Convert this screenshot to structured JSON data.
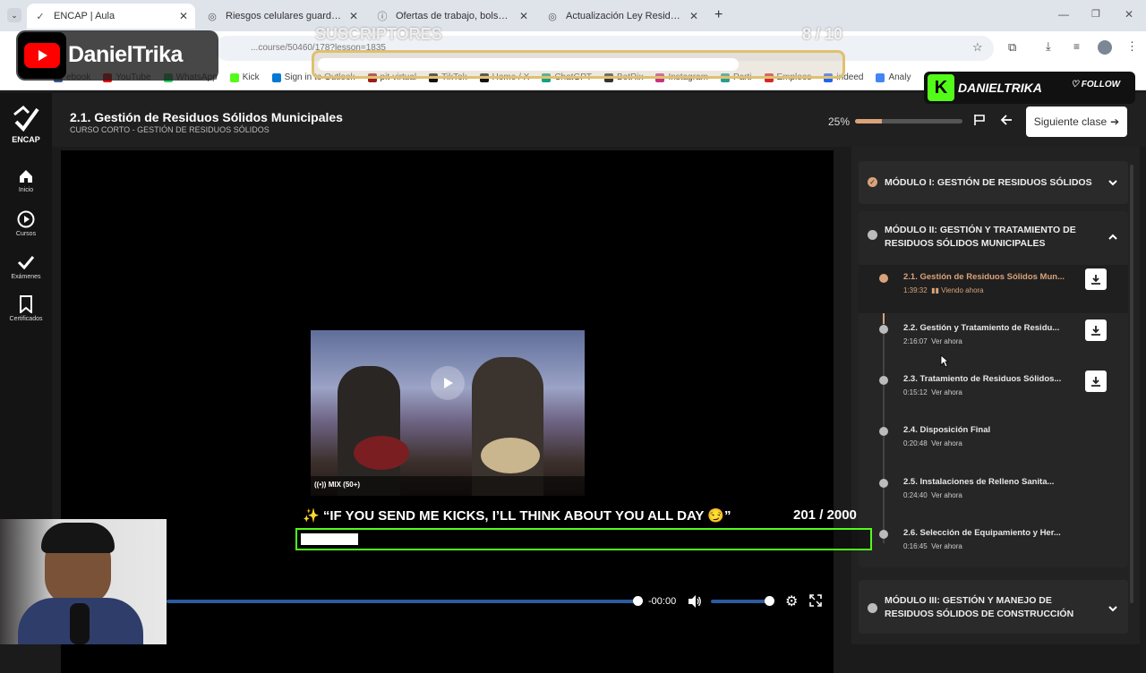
{
  "browser": {
    "tabs": [
      {
        "label": "ENCAP | Aula",
        "icon": "encap-icon",
        "active": true
      },
      {
        "label": "Riesgos celulares guardados",
        "icon": "globe-icon",
        "active": false
      },
      {
        "label": "Ofertas de trabajo, bolsa de tra",
        "icon": "info-icon",
        "active": false
      },
      {
        "label": "Actualización Ley Residuos",
        "icon": "globe-icon",
        "active": false
      }
    ],
    "new_tab": "+",
    "url": "...course/50460/178?lesson=1835",
    "bookmarks": [
      "ebook",
      "YouTube",
      "WhatsApp",
      "Kick",
      "Sign in to Outlook",
      "pit-virtual",
      "TikTok",
      "Home / X",
      "ChatGPT",
      "BotRix",
      "Instagram",
      "Parti",
      "Empleos",
      "indeed",
      "Analy"
    ]
  },
  "overlay": {
    "channel": "DanielTrika",
    "subs_label": "SUSCRIPTORES",
    "subs_count": "8 / 10",
    "kick_name": "DANIELTRIKA",
    "follow": "FOLLOW",
    "kicks_message": "✨ “IF YOU SEND ME KICKS, I’LL THINK ABOUT YOU ALL DAY 😏”",
    "kicks_count": "201 / 2000",
    "kicks_progress": 0.1
  },
  "nav": {
    "brand": "ENCAP",
    "items": [
      {
        "label": "Inicio",
        "icon": "home-icon"
      },
      {
        "label": "Cursos",
        "icon": "play-circle-icon"
      },
      {
        "label": "Exámenes",
        "icon": "check-icon"
      },
      {
        "label": "Certificados",
        "icon": "bookmark-icon"
      }
    ]
  },
  "header": {
    "title": "2.1. Gestión de Residuos Sólidos Municipales",
    "subtitle": "CURSO CORTO - GESTIÓN DE RESIDUOS SÓLIDOS",
    "progress_label": "25%",
    "progress": 0.25,
    "next_label": "Siguiente clase"
  },
  "video": {
    "thumb_caption": "MIX (50+)",
    "time": "-00:00",
    "seek_progress": 1.0,
    "volume": 1.0
  },
  "sidebar": {
    "modules": [
      {
        "title": "MÓDULO I: GESTIÓN DE RESIDUOS SÓLIDOS",
        "completed": true,
        "expanded": false
      },
      {
        "title": "MÓDULO II: GESTIÓN Y TRATAMIENTO DE RESIDUOS SÓLIDOS MUNICIPALES",
        "completed": false,
        "expanded": true
      },
      {
        "title": "MÓDULO III: GESTIÓN Y MANEJO DE RESIDUOS SÓLIDOS DE CONSTRUCCIÓN",
        "completed": false,
        "expanded": false
      }
    ],
    "lessons": [
      {
        "title": "2.1. Gestión de Residuos Sólidos Mun...",
        "duration": "1:39:32",
        "status": "▮▮ Viendo ahora",
        "current": true,
        "download": true
      },
      {
        "title": "2.2. Gestión y Tratamiento de Residu...",
        "duration": "2:16:07",
        "status": "Ver ahora",
        "current": false,
        "download": true
      },
      {
        "title": "2.3. Tratamiento de Residuos Sólidos...",
        "duration": "0:15:12",
        "status": "Ver ahora",
        "current": false,
        "download": true
      },
      {
        "title": "2.4. Disposición Final",
        "duration": "0:20:48",
        "status": "Ver ahora",
        "current": false,
        "download": false
      },
      {
        "title": "2.5. Instalaciones de Relleno Sanita...",
        "duration": "0:24:40",
        "status": "Ver ahora",
        "current": false,
        "download": false
      },
      {
        "title": "2.6. Selección de Equipamiento y Her...",
        "duration": "0:16:45",
        "status": "Ver ahora",
        "current": false,
        "download": false
      }
    ]
  },
  "colors": {
    "accent": "#d9a27a",
    "kick_green": "#53fc18",
    "youtube_red": "#ff0000"
  }
}
